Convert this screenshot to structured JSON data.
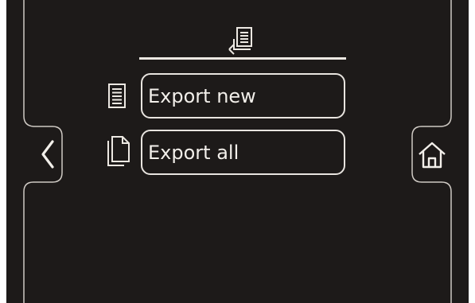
{
  "header": {
    "icon": "export-tray-icon"
  },
  "menu": {
    "items": [
      {
        "label": "Export new",
        "icon": "document-lines-icon"
      },
      {
        "label": "Export all",
        "icon": "documents-stack-icon"
      }
    ]
  },
  "nav": {
    "back_icon": "chevron-left-icon",
    "home_icon": "home-icon"
  },
  "colors": {
    "background": "#1d1a19",
    "foreground": "#e8e4df"
  }
}
